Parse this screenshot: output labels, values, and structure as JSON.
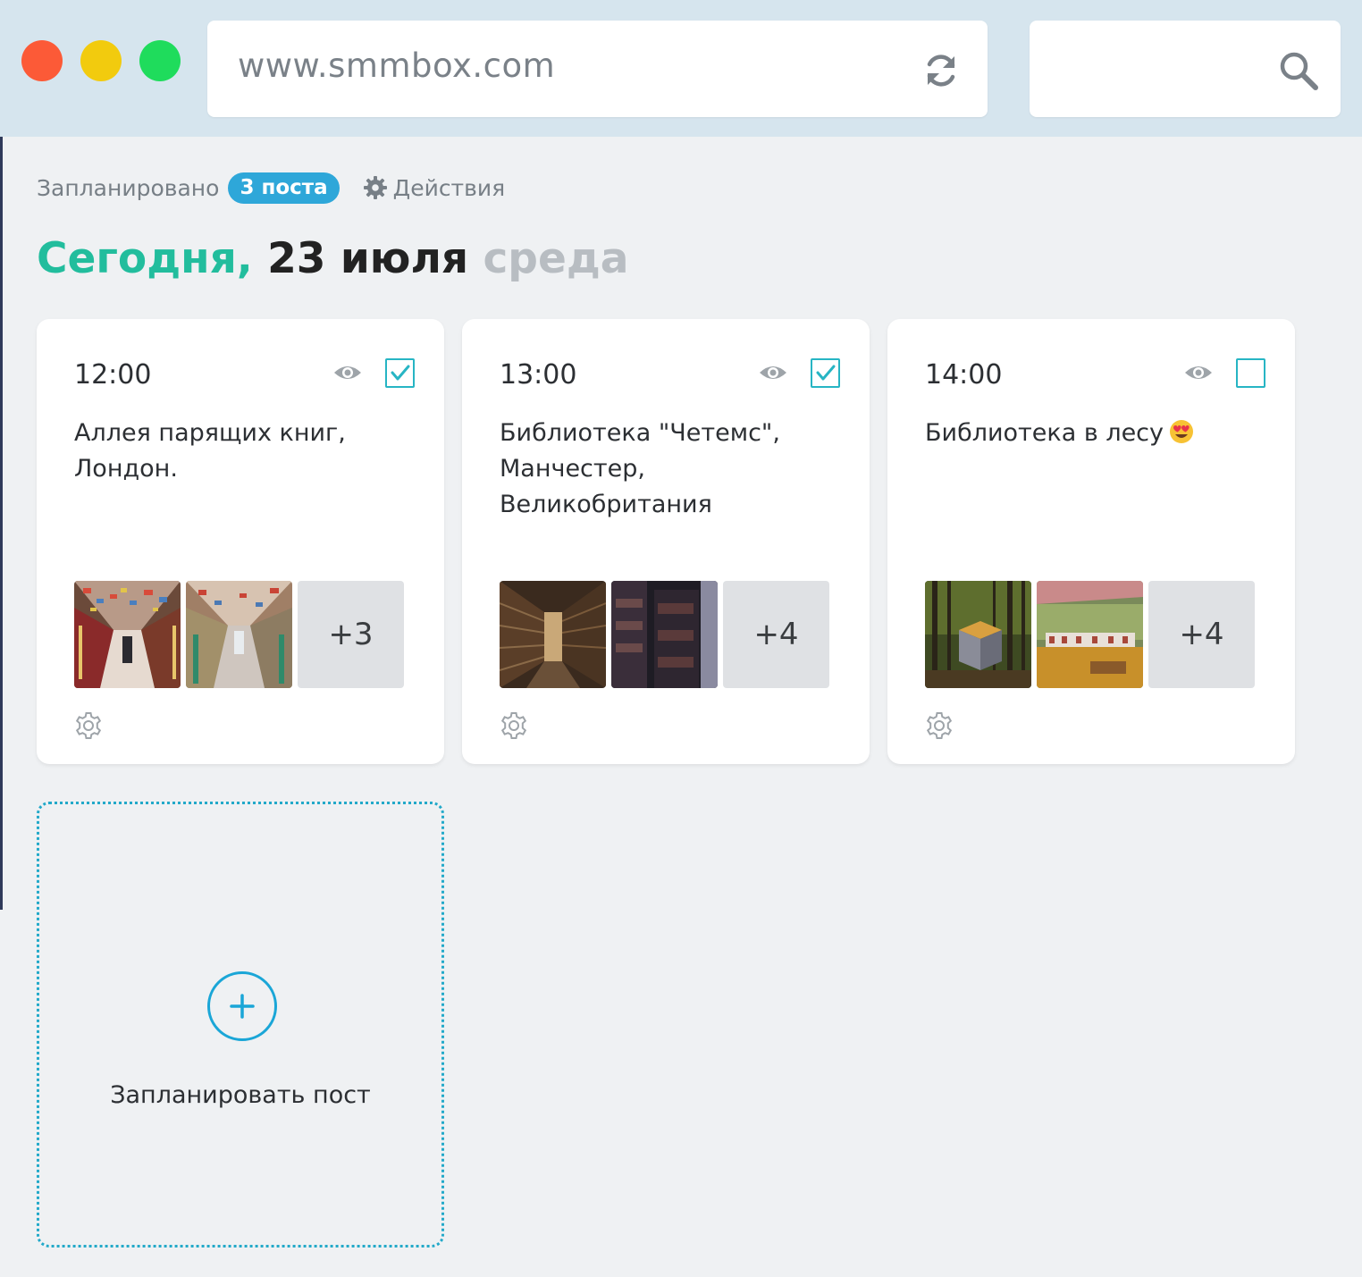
{
  "browser": {
    "url": "www.smmbox.com",
    "search_value": "",
    "window_controls": [
      "close",
      "minimize",
      "maximize"
    ],
    "icons": {
      "reload": "reload-icon",
      "search": "search-icon"
    }
  },
  "summary": {
    "label": "Запланировано",
    "badge": "3 поста",
    "actions_label": "Действия"
  },
  "date": {
    "today": "Сегодня,",
    "date": "23 июля",
    "weekday": "среда"
  },
  "colors": {
    "accent_green": "#22bd9d",
    "accent_blue": "#2ea7d9",
    "checkbox": "#27b5c4"
  },
  "posts": [
    {
      "time": "12:00",
      "text": "Аллея парящих книг, Лондон.",
      "checked": true,
      "more": "+3",
      "emoji": ""
    },
    {
      "time": "13:00",
      "text": "Библиотека \"Четемс\", Манчестер, Великобритания",
      "checked": true,
      "more": "+4",
      "emoji": ""
    },
    {
      "time": "14:00",
      "text": "Библиотека в лесу",
      "checked": false,
      "more": "+4",
      "emoji": "heart-eyes-emoji"
    }
  ],
  "add_post": {
    "label": "Запланировать пост"
  }
}
